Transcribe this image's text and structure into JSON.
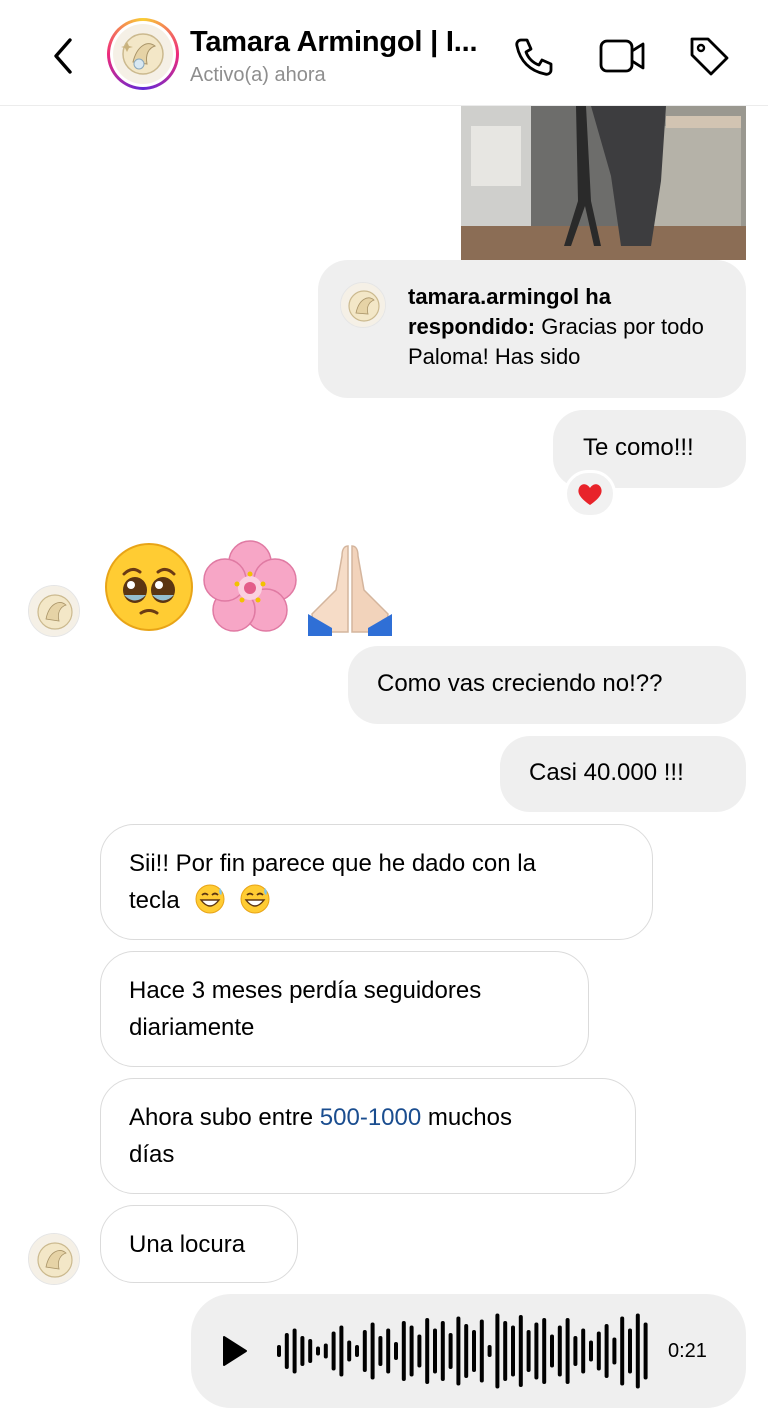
{
  "header": {
    "title": "Tamara Armingol | I...",
    "status": "Activo(a) ahora"
  },
  "messages": {
    "reply": {
      "user": "tamara.armingol ha respondido:",
      "text": "Gracias por todo Paloma! Has sido"
    },
    "te_como": "Te como!!!",
    "reaction": "heart",
    "emojis": [
      "pleading-face",
      "cherry-blossom",
      "folded-hands"
    ],
    "como_vas": "Como vas creciendo no!??",
    "casi": "Casi 40.000 !!!",
    "sii_line1": "Sii!! Por fin parece que he dado con la",
    "sii_line2": "tecla",
    "hace_line1": "Hace 3 meses perdía seguidores",
    "hace_line2": "diariamente",
    "ahora_pre": "Ahora subo entre ",
    "ahora_link": "500-1000",
    "ahora_post": " muchos",
    "ahora_line2": "días",
    "locura": "Una locura",
    "voice": {
      "duration": "0:21"
    }
  },
  "colors": {
    "link": "#1a4d8f",
    "heart": "#e8232a",
    "sent_bubble": "#efefef"
  }
}
